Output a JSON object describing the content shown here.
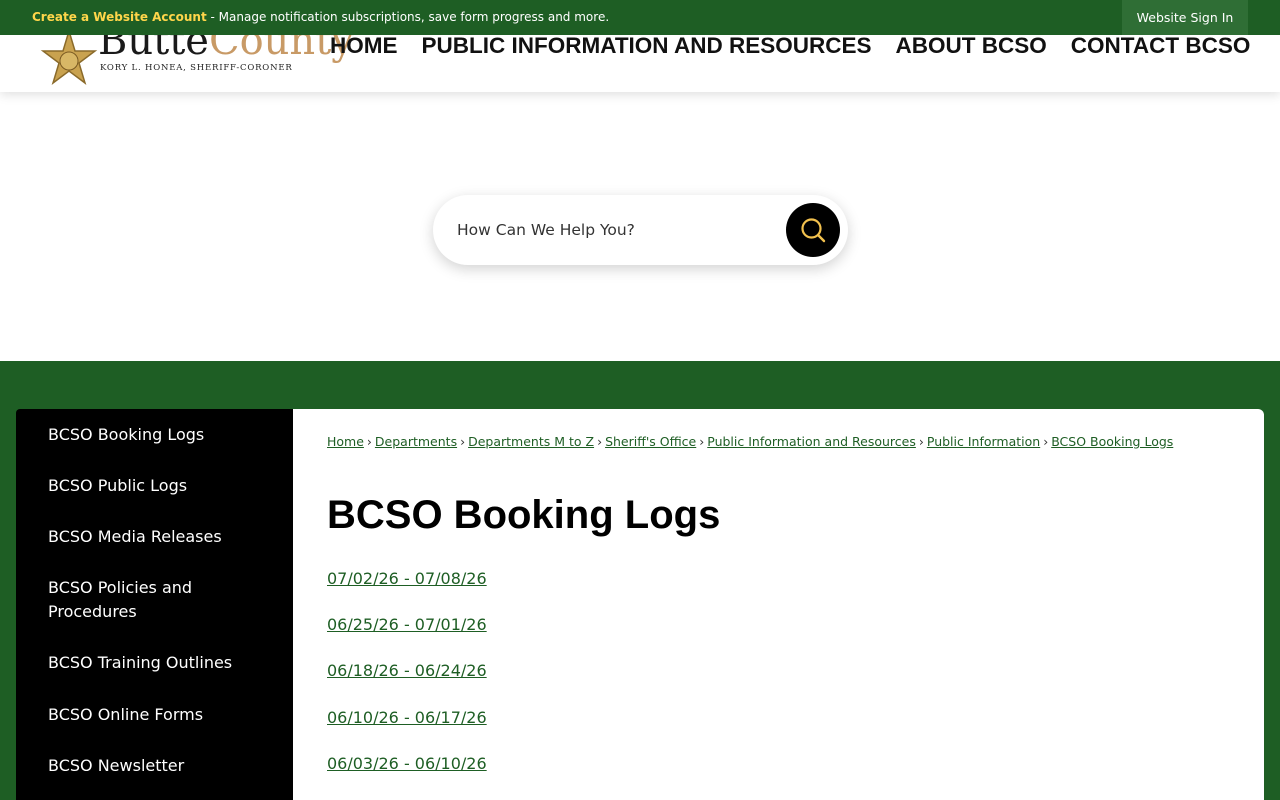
{
  "topbar": {
    "create_account": "Create a Website Account",
    "create_desc": " - Manage notification subscriptions, save form progress and more.",
    "sign_in": "Website Sign In"
  },
  "logo": {
    "word_part1": "Butte",
    "word_part2": "County",
    "tagline": "KORY L. HONEA, SHERIFF-CORONER"
  },
  "nav": [
    "HOME",
    "PUBLIC INFORMATION AND RESOURCES",
    "ABOUT BCSO",
    "CONTACT BCSO"
  ],
  "search": {
    "placeholder": "How Can We Help You?"
  },
  "sidebar": {
    "items": [
      "BCSO Booking Logs",
      "BCSO Public Logs",
      "BCSO Media Releases",
      "BCSO Policies and Procedures",
      "BCSO Training Outlines",
      "BCSO Online Forms",
      "BCSO Newsletter"
    ]
  },
  "breadcrumb": [
    "Home",
    "Departments",
    "Departments M to Z",
    "Sheriff's Office",
    "Public Information and Resources",
    "Public Information",
    "BCSO Booking Logs"
  ],
  "breadcrumb_sep": "›",
  "page": {
    "title": "BCSO Booking Logs"
  },
  "logs": [
    "07/02/26 - 07/08/26",
    "06/25/26 - 07/01/26",
    "06/18/26 - 06/24/26",
    "06/10/26 - 06/17/26",
    "06/03/26 - 06/10/26"
  ],
  "colors": {
    "brand_green": "#1e5e24",
    "accent_yellow": "#ffd64a",
    "logo_gold": "#c89a66"
  },
  "icons": {
    "search_button": "search-icon",
    "logo_badge": "star-badge-icon"
  }
}
